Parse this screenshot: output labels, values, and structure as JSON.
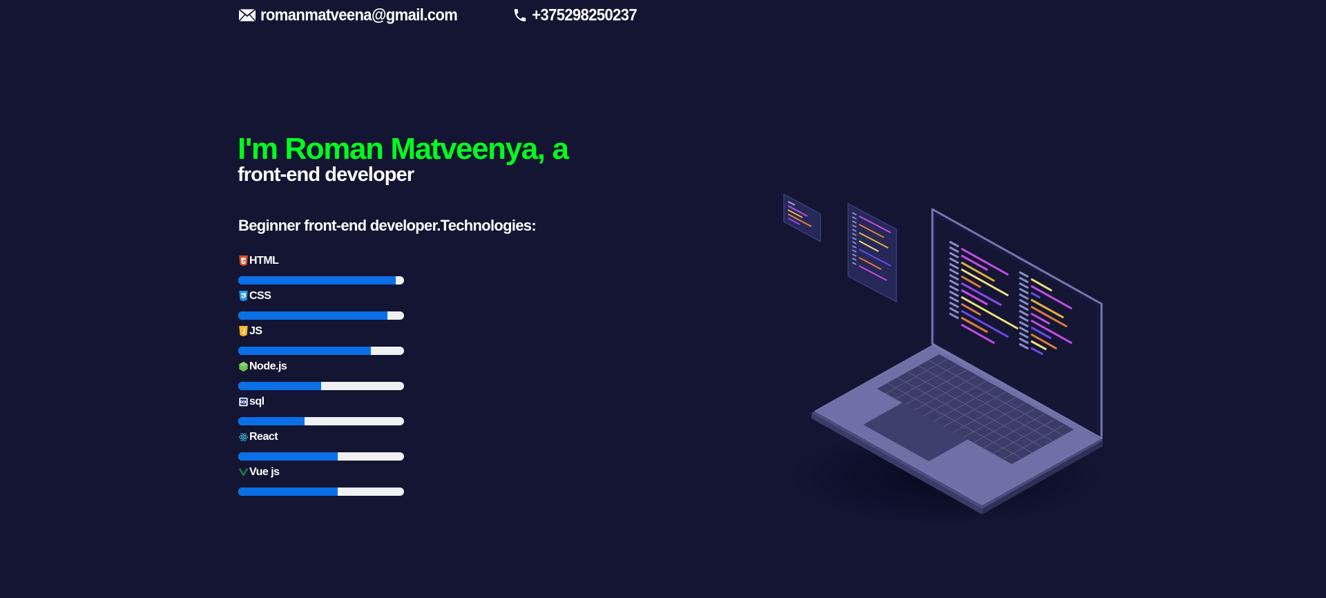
{
  "contacts": {
    "email": "romanmatveena@gmail.com",
    "phone": "+375298250237",
    "email_icon": "envelope-icon",
    "phone_icon": "phone-icon"
  },
  "hero": {
    "title": "I'm Roman Matveenya, a",
    "subtitle": "front-end developer",
    "intro": "Beginner front-end developer.Technologies:"
  },
  "colors": {
    "background": "#131532",
    "title": "#00ff1e",
    "bar_fill": "#0b6fe8",
    "bar_track": "#eef0f4"
  },
  "skills": [
    {
      "name": "HTML",
      "icon": "html5-icon",
      "level": 0.95
    },
    {
      "name": "CSS",
      "icon": "css3-icon",
      "level": 0.9
    },
    {
      "name": "JS",
      "icon": "js-icon",
      "level": 0.8
    },
    {
      "name": "Node.js",
      "icon": "nodejs-icon",
      "level": 0.5
    },
    {
      "name": "sql",
      "icon": "sql-icon",
      "level": 0.4
    },
    {
      "name": "React",
      "icon": "react-icon",
      "level": 0.6
    },
    {
      "name": "Vue js",
      "icon": "vue-icon",
      "level": 0.6
    }
  ],
  "illustration": {
    "icon": "laptop-code-illustration"
  }
}
